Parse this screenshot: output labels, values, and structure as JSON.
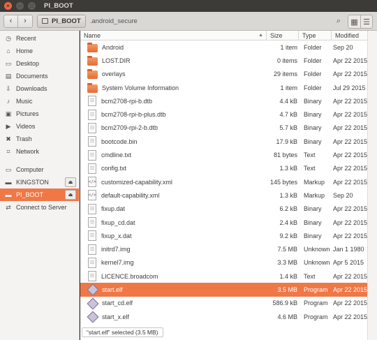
{
  "window": {
    "title": "PI_BOOT"
  },
  "toolbar": {
    "crumb_active": "PI_BOOT",
    "crumb_next": ".android_secure"
  },
  "sidebar": {
    "places": [
      {
        "label": "Recent",
        "icon": "clock-icon"
      },
      {
        "label": "Home",
        "icon": "home-icon"
      },
      {
        "label": "Desktop",
        "icon": "desktop-icon"
      },
      {
        "label": "Documents",
        "icon": "documents-icon"
      },
      {
        "label": "Downloads",
        "icon": "download-icon"
      },
      {
        "label": "Music",
        "icon": "music-icon"
      },
      {
        "label": "Pictures",
        "icon": "pictures-icon"
      },
      {
        "label": "Videos",
        "icon": "videos-icon"
      },
      {
        "label": "Trash",
        "icon": "trash-icon"
      },
      {
        "label": "Network",
        "icon": "network-icon"
      }
    ],
    "devices": [
      {
        "label": "Computer",
        "icon": "computer-icon"
      },
      {
        "label": "KINGSTON",
        "icon": "drive-icon"
      },
      {
        "label": "PI_BOOT",
        "icon": "drive-icon"
      }
    ],
    "connect": {
      "label": "Connect to Server",
      "icon": "server-icon"
    }
  },
  "columns": {
    "name": "Name",
    "size": "Size",
    "type": "Type",
    "modified": "Modified"
  },
  "files": [
    {
      "name": "Android",
      "size": "1 item",
      "type": "Folder",
      "modified": "Sep 20",
      "icon": "folder"
    },
    {
      "name": "LOST.DIR",
      "size": "0 items",
      "type": "Folder",
      "modified": "Apr 22 2015",
      "icon": "folder"
    },
    {
      "name": "overlays",
      "size": "29 items",
      "type": "Folder",
      "modified": "Apr 22 2015",
      "icon": "folder"
    },
    {
      "name": "System Volume Information",
      "size": "1 item",
      "type": "Folder",
      "modified": "Jul 29 2015",
      "icon": "folder"
    },
    {
      "name": "bcm2708-rpi-b.dtb",
      "size": "4.4 kB",
      "type": "Binary",
      "modified": "Apr 22 2015",
      "icon": "file"
    },
    {
      "name": "bcm2708-rpi-b-plus.dtb",
      "size": "4.7 kB",
      "type": "Binary",
      "modified": "Apr 22 2015",
      "icon": "file"
    },
    {
      "name": "bcm2709-rpi-2-b.dtb",
      "size": "5.7 kB",
      "type": "Binary",
      "modified": "Apr 22 2015",
      "icon": "file"
    },
    {
      "name": "bootcode.bin",
      "size": "17.9 kB",
      "type": "Binary",
      "modified": "Apr 22 2015",
      "icon": "file"
    },
    {
      "name": "cmdline.txt",
      "size": "81 bytes",
      "type": "Text",
      "modified": "Apr 22 2015",
      "icon": "file"
    },
    {
      "name": "config.txt",
      "size": "1.3 kB",
      "type": "Text",
      "modified": "Apr 22 2015",
      "icon": "file"
    },
    {
      "name": "customized-capability.xml",
      "size": "145 bytes",
      "type": "Markup",
      "modified": "Apr 22 2015",
      "icon": "markup"
    },
    {
      "name": "default-capability.xml",
      "size": "1.3 kB",
      "type": "Markup",
      "modified": "Sep 20",
      "icon": "markup"
    },
    {
      "name": "fixup.dat",
      "size": "6.2 kB",
      "type": "Binary",
      "modified": "Apr 22 2015",
      "icon": "file"
    },
    {
      "name": "fixup_cd.dat",
      "size": "2.4 kB",
      "type": "Binary",
      "modified": "Apr 22 2015",
      "icon": "file"
    },
    {
      "name": "fixup_x.dat",
      "size": "9.2 kB",
      "type": "Binary",
      "modified": "Apr 22 2015",
      "icon": "file"
    },
    {
      "name": "initrd7.img",
      "size": "7.5 MB",
      "type": "Unknown",
      "modified": "Jan 1 1980",
      "icon": "file"
    },
    {
      "name": "kernel7.img",
      "size": "3.3 MB",
      "type": "Unknown",
      "modified": "Apr 5 2015",
      "icon": "file"
    },
    {
      "name": "LICENCE.broadcom",
      "size": "1.4 kB",
      "type": "Text",
      "modified": "Apr 22 2015",
      "icon": "file"
    },
    {
      "name": "start.elf",
      "size": "3.5 MB",
      "type": "Program",
      "modified": "Apr 22 2015",
      "icon": "program",
      "selected": true
    },
    {
      "name": "start_cd.elf",
      "size": "586.9 kB",
      "type": "Program",
      "modified": "Apr 22 2015",
      "icon": "program"
    },
    {
      "name": "start_x.elf",
      "size": "4.6 MB",
      "type": "Program",
      "modified": "Apr 22 2015",
      "icon": "program"
    }
  ],
  "status": {
    "text": "“start.elf” selected  (3.5 MB)"
  }
}
